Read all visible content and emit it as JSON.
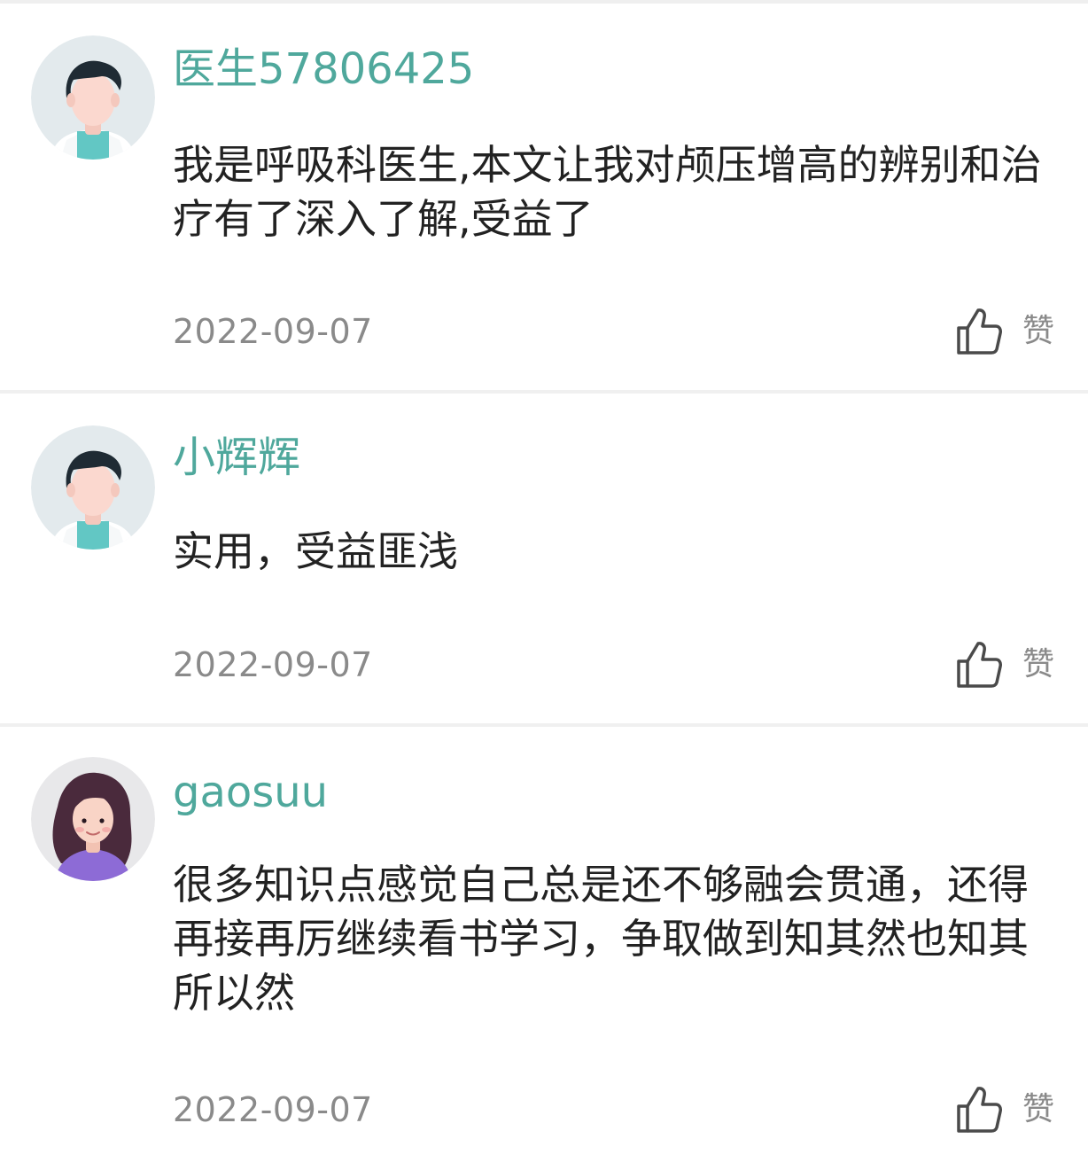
{
  "comments": [
    {
      "username": "医生57806425",
      "avatar": "male-doctor-avatar",
      "text": "我是呼吸科医生,本文让我对颅压增高的辨别和治疗有了深入了解,受益了",
      "date": "2022-09-07",
      "like_label": "赞"
    },
    {
      "username": "小辉辉",
      "avatar": "male-doctor-avatar",
      "text": "实用，受益匪浅",
      "date": "2022-09-07",
      "like_label": "赞"
    },
    {
      "username": "gaosuu",
      "avatar": "female-avatar",
      "text": "很多知识点感觉自己总是还不够融会贯通，还得再接再厉继续看书学习，争取做到知其然也知其所以然",
      "date": "2022-09-07",
      "like_label": "赞"
    }
  ],
  "colors": {
    "username": "#4fa89c",
    "text": "#222222",
    "meta": "#8a8a8a",
    "divider": "#f0f0f0"
  },
  "icons": {
    "like": "thumbs-up-icon"
  }
}
